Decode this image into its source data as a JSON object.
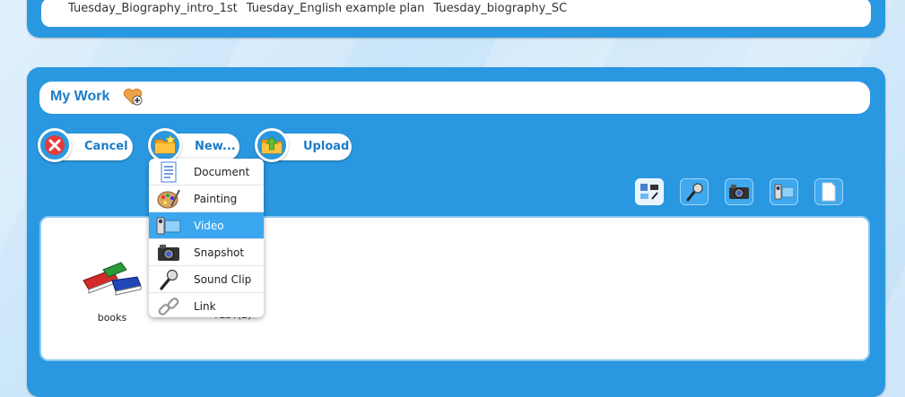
{
  "top_panel": {
    "recent_items": [
      "Tuesday_Biography_intro_1st",
      "Tuesday_English example plan",
      "Tuesday_biography_SC"
    ]
  },
  "main": {
    "title": "My Work",
    "buttons": {
      "cancel": "Cancel",
      "new": "New...",
      "upload": "Upload"
    },
    "type_filters": [
      "all-media-icon",
      "microphone-icon",
      "camera-icon",
      "video-icon",
      "document-icon"
    ],
    "items": [
      {
        "label": "books"
      },
      {
        "label": "TEST(2)"
      }
    ]
  },
  "new_menu": {
    "items": [
      {
        "label": "Document",
        "icon": "document-icon"
      },
      {
        "label": "Painting",
        "icon": "palette-icon"
      },
      {
        "label": "Video",
        "icon": "video-icon",
        "active": true
      },
      {
        "label": "Snapshot",
        "icon": "camera-icon"
      },
      {
        "label": "Sound Clip",
        "icon": "microphone-icon"
      },
      {
        "label": "Link",
        "icon": "link-icon"
      }
    ]
  },
  "colors": {
    "panel_blue": "#2a98e0",
    "label_blue": "#1c7cc7",
    "menu_active": "#3ca7f1"
  }
}
